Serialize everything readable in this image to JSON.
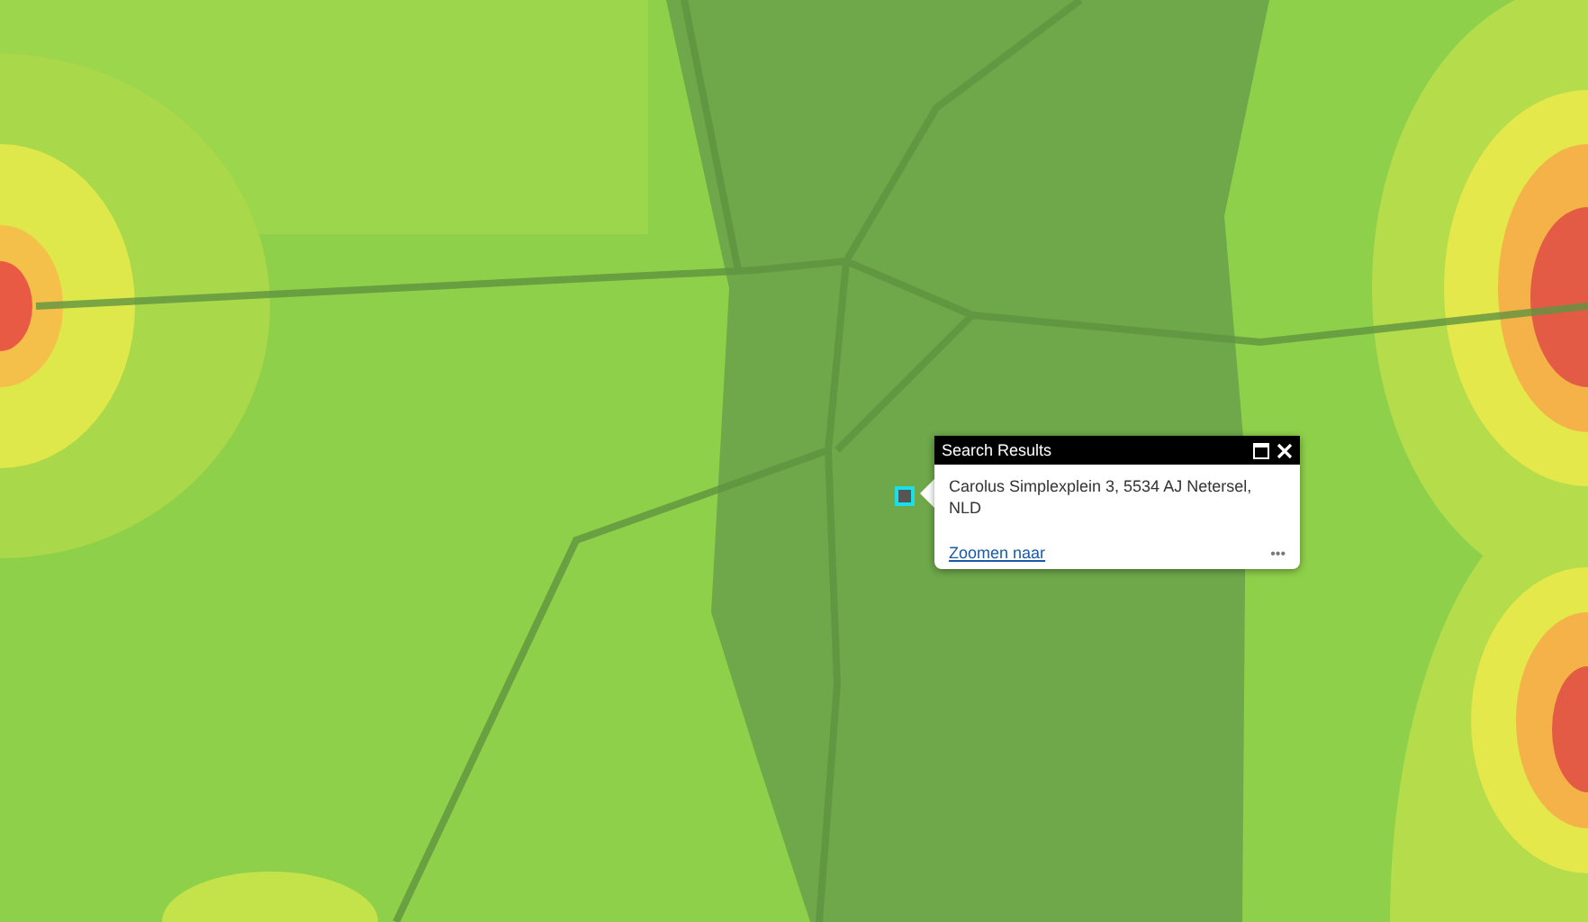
{
  "popup": {
    "title": "Search Results",
    "address": "Carolus Simplexplein 3, 5534 AJ Netersel, NLD",
    "zoom_link": "Zoomen naar",
    "more": "•••"
  }
}
